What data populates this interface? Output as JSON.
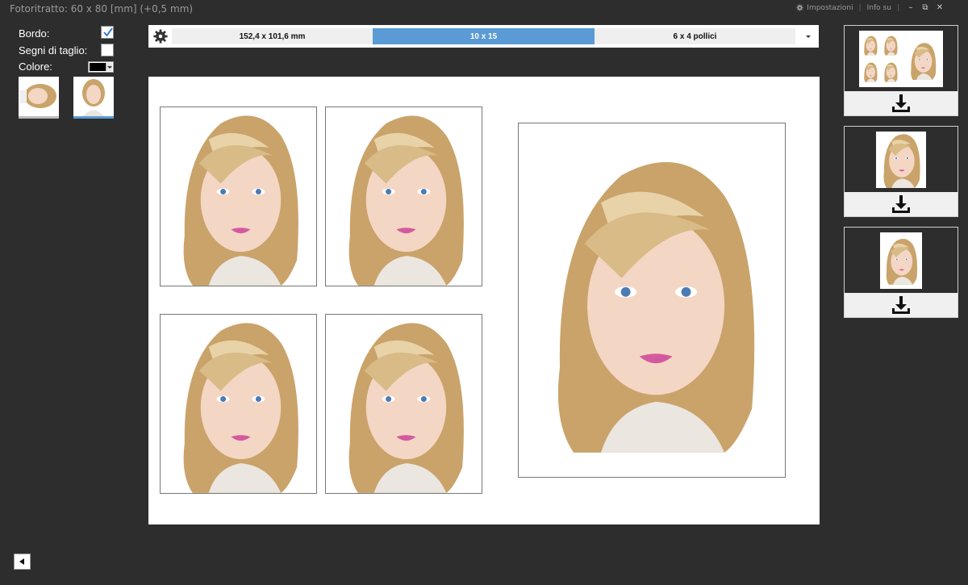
{
  "titlebar": {
    "title": "Fotoritratto: 60 x 80 [mm] (+0,5 mm)",
    "settings_label": "Impostazioni",
    "info_label": "Info su"
  },
  "options": {
    "border_label": "Bordo:",
    "border_checked": true,
    "cut_marks_label": "Segni di taglio:",
    "cut_marks_checked": false,
    "color_label": "Colore:",
    "color_value": "#000000"
  },
  "toolbar": {
    "formats": [
      {
        "label": "152,4 x 101,6 mm",
        "active": false
      },
      {
        "label": "10 x 15",
        "active": true
      },
      {
        "label": "6 x 4 pollici",
        "active": false
      }
    ]
  },
  "canvas": {
    "small_photos": 4,
    "large_photos": 1
  },
  "presets": [
    {
      "name": "sheet-layout"
    },
    {
      "name": "single-portrait"
    },
    {
      "name": "small-portrait"
    }
  ],
  "colors": {
    "background": "#2d2d2d",
    "accent": "#5b9bd5",
    "hair": "#c9a36a",
    "skin": "#f3d6c3"
  }
}
